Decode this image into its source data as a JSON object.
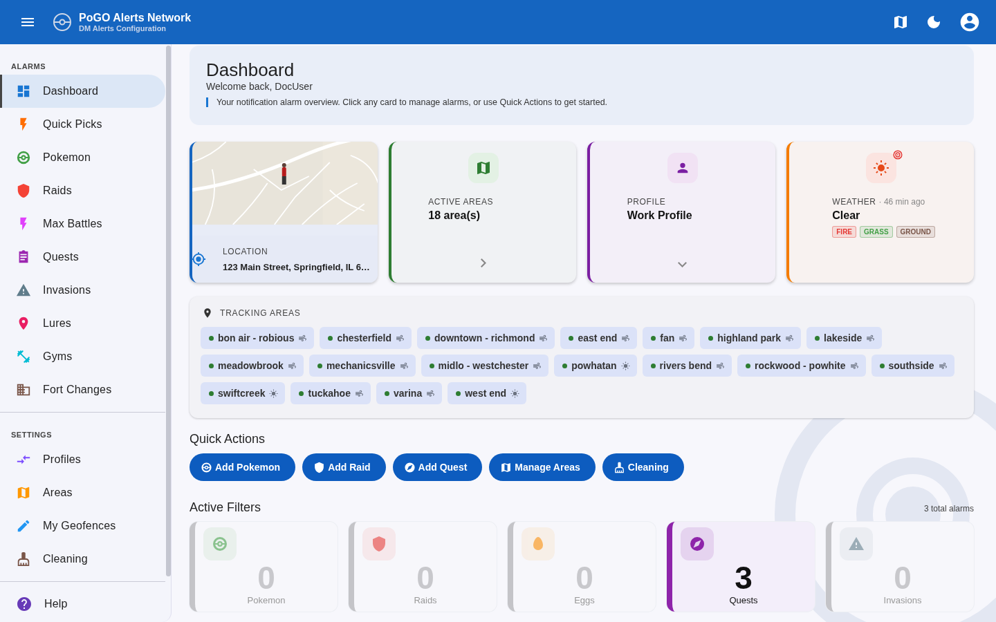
{
  "app_bar": {
    "title": "PoGO Alerts Network",
    "subtitle": "DM Alerts Configuration"
  },
  "sidebar": {
    "sections": [
      {
        "title": "ALARMS",
        "items": [
          {
            "label": "Dashboard",
            "selected": true
          },
          {
            "label": "Quick Picks",
            "selected": false
          },
          {
            "label": "Pokemon",
            "selected": false
          },
          {
            "label": "Raids",
            "selected": false
          },
          {
            "label": "Max Battles",
            "selected": false
          },
          {
            "label": "Quests",
            "selected": false
          },
          {
            "label": "Invasions",
            "selected": false
          },
          {
            "label": "Lures",
            "selected": false
          },
          {
            "label": "Gyms",
            "selected": false
          },
          {
            "label": "Fort Changes",
            "selected": false
          }
        ]
      },
      {
        "title": "SETTINGS",
        "items": [
          {
            "label": "Profiles",
            "selected": false
          },
          {
            "label": "Areas",
            "selected": false
          },
          {
            "label": "My Geofences",
            "selected": false
          },
          {
            "label": "Cleaning",
            "selected": false
          }
        ]
      }
    ],
    "footer_items": [
      {
        "label": "Help",
        "selected": false
      }
    ]
  },
  "header": {
    "title": "Dashboard",
    "welcome": "Welcome back, DocUser",
    "note": "Your notification alarm overview. Click any card to manage alarms, or use Quick Actions to get started."
  },
  "location_card": {
    "label": "LOCATION",
    "address": "123 Main Street, Springfield, IL 6…"
  },
  "areas_card": {
    "label": "ACTIVE AREAS",
    "value": "18 area(s)"
  },
  "profile_card": {
    "label": "PROFILE",
    "value": "Work Profile"
  },
  "weather_card": {
    "label": "WEATHER",
    "age": "· 46 min ago",
    "value": "Clear",
    "types": [
      {
        "label": "FIRE",
        "color": "#e53935"
      },
      {
        "label": "GRASS",
        "color": "#43a047"
      },
      {
        "label": "GROUND",
        "color": "#795548"
      }
    ]
  },
  "tracking_areas": {
    "title": "TRACKING AREAS",
    "areas": [
      {
        "name": "bon air - robious",
        "kind": "wind"
      },
      {
        "name": "chesterfield",
        "kind": "wind"
      },
      {
        "name": "downtown - richmond",
        "kind": "wind"
      },
      {
        "name": "east end",
        "kind": "wind"
      },
      {
        "name": "fan",
        "kind": "wind"
      },
      {
        "name": "highland park",
        "kind": "wind"
      },
      {
        "name": "lakeside",
        "kind": "wind"
      },
      {
        "name": "meadowbrook",
        "kind": "wind"
      },
      {
        "name": "mechanicsville",
        "kind": "wind"
      },
      {
        "name": "midlo - westchester",
        "kind": "wind"
      },
      {
        "name": "powhatan",
        "kind": "sun"
      },
      {
        "name": "rivers bend",
        "kind": "wind"
      },
      {
        "name": "rockwood - powhite",
        "kind": "wind"
      },
      {
        "name": "southside",
        "kind": "wind"
      },
      {
        "name": "swiftcreek",
        "kind": "sun"
      },
      {
        "name": "tuckahoe",
        "kind": "wind"
      },
      {
        "name": "varina",
        "kind": "wind"
      },
      {
        "name": "west end",
        "kind": "sun"
      }
    ]
  },
  "quick_actions": {
    "title": "Quick Actions",
    "buttons": [
      "Add Pokemon",
      "Add Raid",
      "Add Quest",
      "Manage Areas",
      "Cleaning"
    ]
  },
  "active_filters": {
    "title": "Active Filters",
    "total": "3 total alarms",
    "cards": [
      {
        "count": "0",
        "label": "Pokemon",
        "active": false
      },
      {
        "count": "0",
        "label": "Raids",
        "active": false
      },
      {
        "count": "0",
        "label": "Eggs",
        "active": false
      },
      {
        "count": "3",
        "label": "Quests",
        "active": true
      },
      {
        "count": "0",
        "label": "Invasions",
        "active": false
      }
    ]
  }
}
